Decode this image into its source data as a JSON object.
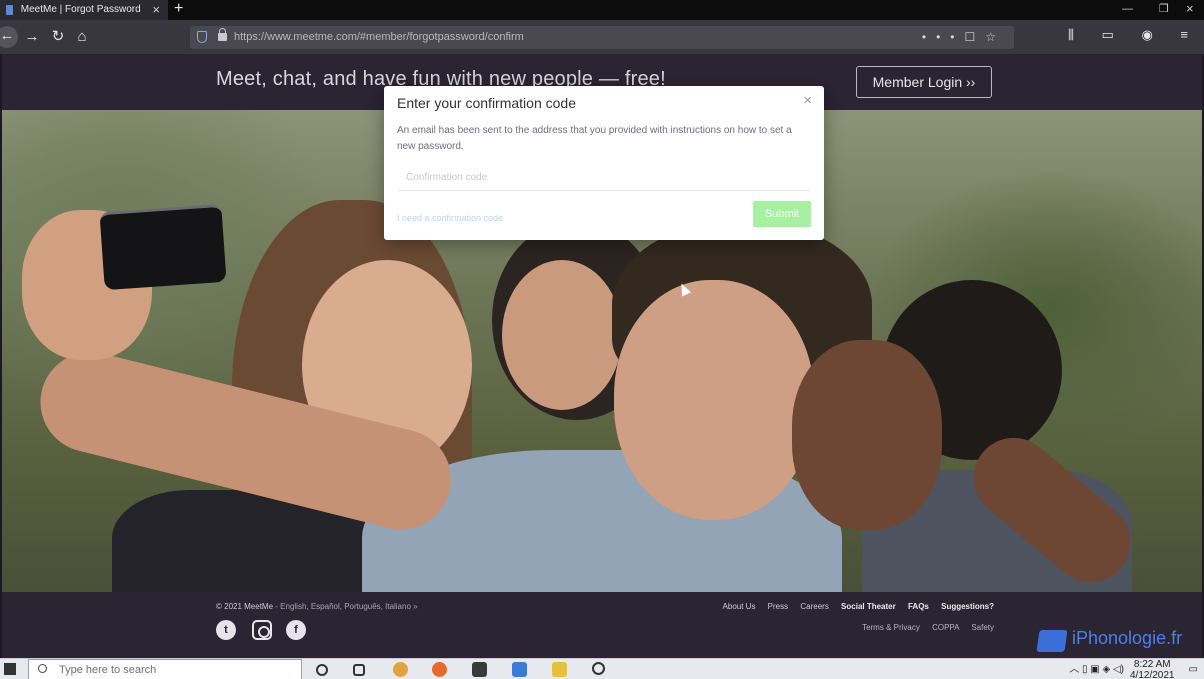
{
  "browser": {
    "tab_title": "MeetMe | Forgot Password",
    "url": "https://www.meetme.com/#member/forgotpassword/confirm"
  },
  "site": {
    "tagline": "Meet, chat, and have fun with new people — free!",
    "member_login": "Member Login ››"
  },
  "modal": {
    "title": "Enter your confirmation code",
    "body": "An email has been sent to the address that you provided with instructions on how to set a new password.",
    "input_placeholder": "Confirmation code",
    "need_code_link": "I need a confirmation code",
    "submit": "Submit"
  },
  "footer": {
    "copyright": "© 2021 MeetMe",
    "languages": " - English, Español, Português, Italiano »",
    "links": [
      "About Us",
      "Press",
      "Careers",
      "Social Theater",
      "FAQs",
      "Suggestions?"
    ],
    "links2": [
      "Terms & Privacy",
      "COPPA",
      "Safety"
    ]
  },
  "watermark": "iPhonologie.fr",
  "taskbar": {
    "search_placeholder": "Type here to search",
    "time": "8:22 AM",
    "date": "4/12/2021"
  },
  "colors": {
    "site_header": "#2b2433",
    "submit_button": "#a6f0a2",
    "link": "#bcd4ef"
  }
}
